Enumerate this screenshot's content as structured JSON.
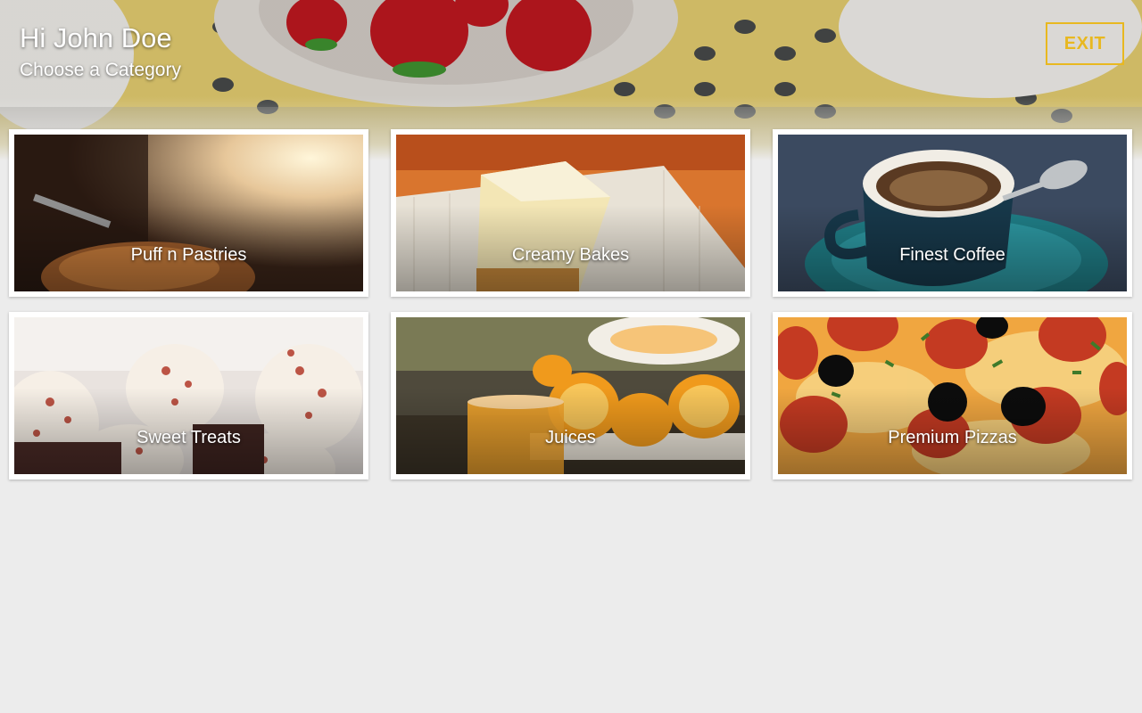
{
  "header": {
    "greeting": "Hi John Doe",
    "subtitle": "Choose a Category",
    "exit_label": "EXIT",
    "accent_color": "#e8b820",
    "background_image": "strawberries-on-patterned-table"
  },
  "categories": [
    {
      "label": "Puff n Pastries",
      "image": "pastry-photo"
    },
    {
      "label": "Creamy Bakes",
      "image": "cheesecake-photo"
    },
    {
      "label": "Finest Coffee",
      "image": "coffee-cup-photo"
    },
    {
      "label": "Sweet Treats",
      "image": "cupcakes-photo"
    },
    {
      "label": "Juices",
      "image": "orange-juice-photo"
    },
    {
      "label": "Premium Pizzas",
      "image": "pepperoni-pizza-photo"
    }
  ]
}
